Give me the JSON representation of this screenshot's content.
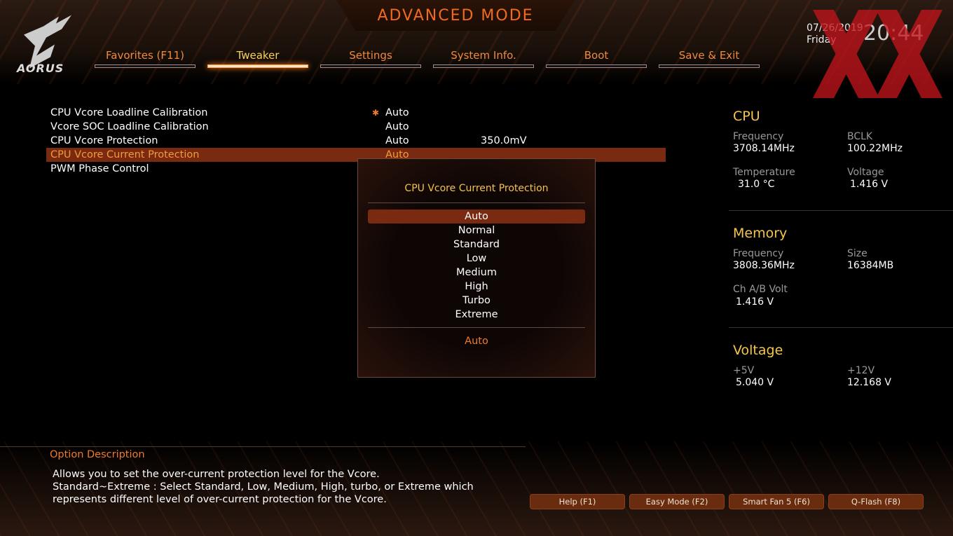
{
  "header": {
    "title": "ADVANCED MODE",
    "logo_text": "AORUS",
    "date": "07/26/2019",
    "day": "Friday",
    "time": "20:44",
    "watermark": "XX"
  },
  "tabs": [
    {
      "label": "Favorites (F11)"
    },
    {
      "label": "Tweaker",
      "active": true
    },
    {
      "label": "Settings"
    },
    {
      "label": "System Info."
    },
    {
      "label": "Boot"
    },
    {
      "label": "Save & Exit"
    }
  ],
  "settings": [
    {
      "label": "CPU Vcore Loadline Calibration",
      "value": "Auto",
      "starred": true
    },
    {
      "label": "Vcore SOC Loadline Calibration",
      "value": "Auto"
    },
    {
      "label": "CPU Vcore Protection",
      "value": "Auto",
      "extra": "350.0mV"
    },
    {
      "label": "CPU Vcore Current Protection",
      "value": "Auto",
      "selected": true
    },
    {
      "label": "PWM Phase Control",
      "value": ""
    }
  ],
  "popup": {
    "title": "CPU Vcore Current Protection",
    "options": [
      "Auto",
      "Normal",
      "Standard",
      "Low",
      "Medium",
      "High",
      "Turbo",
      "Extreme"
    ],
    "selected": "Auto",
    "current": "Auto"
  },
  "cpu": {
    "heading": "CPU",
    "freq_label": "Frequency",
    "freq": "3708.14MHz",
    "bclk_label": "BCLK",
    "bclk": "100.22MHz",
    "temp_label": "Temperature",
    "temp": "31.0 °C",
    "volt_label": "Voltage",
    "volt": "1.416 V"
  },
  "memory": {
    "heading": "Memory",
    "freq_label": "Frequency",
    "freq": "3808.36MHz",
    "size_label": "Size",
    "size": "16384MB",
    "chab_label": "Ch A/B Volt",
    "chab": "1.416 V"
  },
  "voltage": {
    "heading": "Voltage",
    "v5_label": "+5V",
    "v5": "5.040 V",
    "v12_label": "+12V",
    "v12": "12.168 V"
  },
  "description": {
    "heading": "Option Description",
    "lines": [
      "Allows you to set the over-current protection level for the Vcore.",
      "Standard~Extreme : Select Standard, Low, Medium, High, turbo, or Extreme which",
      "represents different level of over-current protection for the Vcore."
    ]
  },
  "buttons": [
    "Help (F1)",
    "Easy Mode (F2)",
    "Smart Fan 5 (F6)",
    "Q-Flash (F8)"
  ],
  "colors": {
    "accent": "#f07a2a",
    "highlight": "#7a2a10",
    "heading": "#f6c64c"
  }
}
